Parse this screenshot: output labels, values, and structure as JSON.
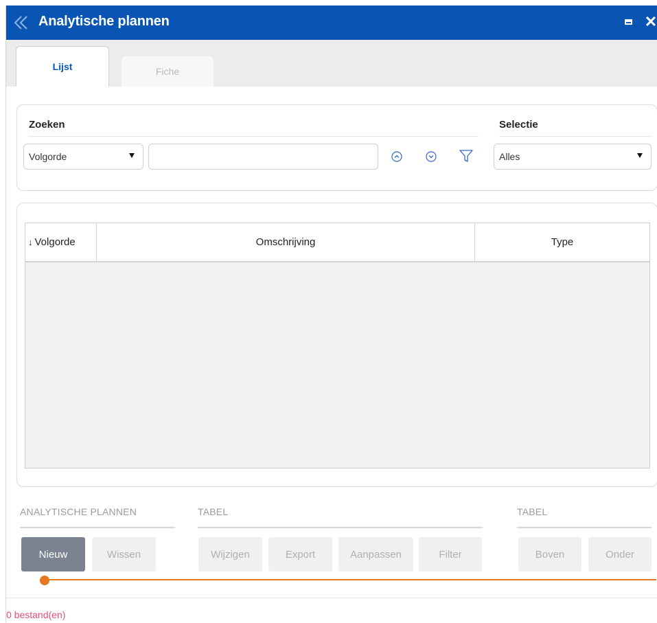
{
  "window": {
    "title": "Analytische plannen",
    "icons": {
      "logo": "app-logo-icon",
      "maximize": "maximize-icon",
      "close": "close-icon"
    },
    "close_glyph": "✕"
  },
  "tabs": [
    {
      "label": "Lijst",
      "active": true
    },
    {
      "label": "Fiche",
      "active": false
    }
  ],
  "search": {
    "heading": "Zoeken",
    "field_select": {
      "value": "Volgorde"
    },
    "query_value": "",
    "icons": [
      "sort-up-icon",
      "sort-down-icon",
      "filter-icon"
    ]
  },
  "selection": {
    "heading": "Selectie",
    "value": "Alles"
  },
  "table": {
    "sort_indicator": "↓",
    "columns": [
      "Volgorde",
      "Omschrijving",
      "Type"
    ],
    "rows": []
  },
  "toolbar": {
    "groups": [
      {
        "title": "ANALYTISCHE PLANNEN",
        "buttons": [
          "Nieuw",
          "Wissen"
        ]
      },
      {
        "title": "TABEL",
        "buttons": [
          "Wijzigen",
          "Export",
          "Aanpassen",
          "Filter"
        ]
      },
      {
        "title": "TABEL",
        "buttons": [
          "Boven",
          "Onder"
        ]
      }
    ]
  },
  "status": {
    "text": "0 bestand(en)"
  },
  "colors": {
    "title_bar": "#0a55b3",
    "primary_button": "#7a838f",
    "status_text": "#e44f7b",
    "indicator": "#e87722"
  }
}
